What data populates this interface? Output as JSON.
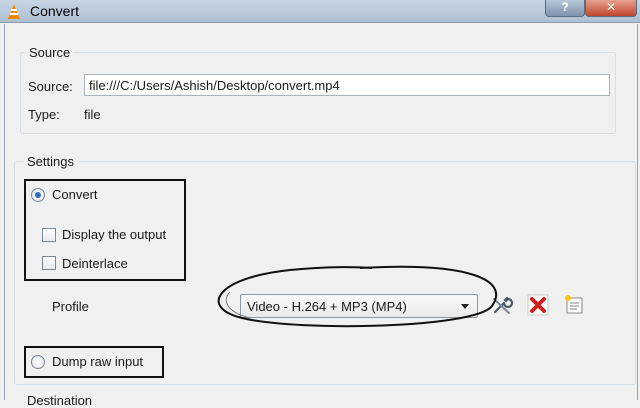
{
  "window": {
    "title": "Convert",
    "help_label": "?",
    "close_label": "✕"
  },
  "source_group": {
    "label": "Source",
    "source_label": "Source:",
    "source_value": "file:///C:/Users/Ashish/Desktop/convert.mp4",
    "type_label": "Type:",
    "type_value": "file"
  },
  "settings_group": {
    "label": "Settings",
    "convert_label": "Convert",
    "convert_checked": true,
    "display_output_label": "Display the output",
    "deinterlace_label": "Deinterlace",
    "profile_label": "Profile",
    "profile_value": "Video - H.264 + MP3 (MP4)",
    "dump_raw_label": "Dump raw input"
  },
  "destination_group": {
    "label": "Destination"
  },
  "icons": [
    "vlc-cone-icon",
    "wrench-icon",
    "delete-icon",
    "new-profile-icon"
  ],
  "colors": {
    "delete": "#d21f1f",
    "annotation": "#111111"
  }
}
